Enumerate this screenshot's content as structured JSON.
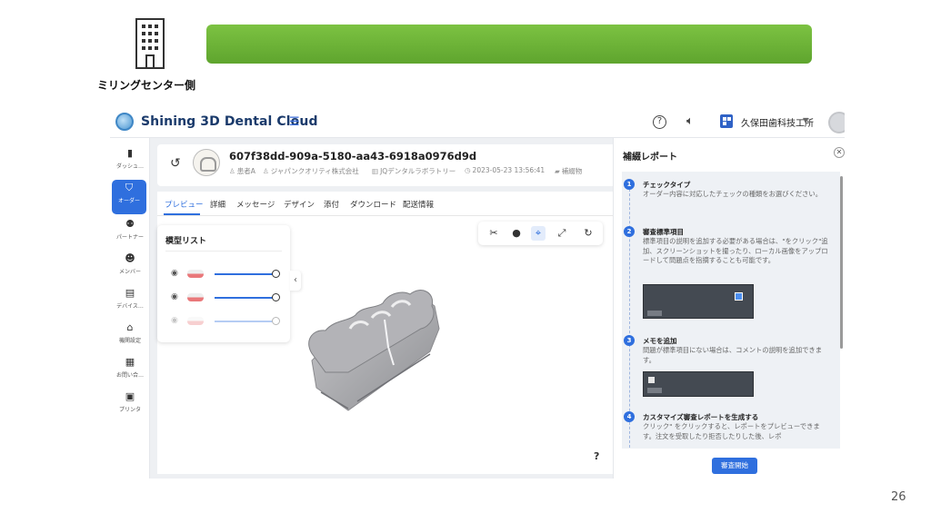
{
  "slide": {
    "label": "ミリングセンター側",
    "page_number": "26",
    "accent_color": "#6ab43a",
    "icon": "building-icon"
  },
  "header": {
    "app_title": "Shining 3D Dental Cloud",
    "company": "久保田歯科技工所"
  },
  "nav": {
    "items": [
      {
        "label": "ダッシュ…",
        "icon": "dashboard-icon"
      },
      {
        "label": "オーダー",
        "icon": "tooth-icon",
        "active": true
      },
      {
        "label": "パートナー",
        "icon": "partner-icon"
      },
      {
        "label": "メンバー",
        "icon": "members-icon"
      },
      {
        "label": "デバイス…",
        "icon": "device-icon"
      },
      {
        "label": "機関設定",
        "icon": "settings-home-icon"
      },
      {
        "label": "お問い合…",
        "icon": "contact-icon"
      },
      {
        "label": "プリンタ",
        "icon": "printer-icon"
      }
    ]
  },
  "order": {
    "id": "607f38dd-909a-5180-aa43-6918a0976d9d",
    "patient": "患者A",
    "clinic": "ジャパンクオリティ株式会社",
    "lab": "JQデンタルラボラトリー",
    "datetime": "2023-05-23 13:56:41",
    "type": "補綴物"
  },
  "tabs": [
    "プレビュー",
    "詳細",
    "メッセージ",
    "デザイン",
    "添付",
    "ダウンロード",
    "配送情報"
  ],
  "model_list": {
    "title": "模型リスト",
    "rows": [
      {
        "visible": true,
        "opacity": 1.0
      },
      {
        "visible": true,
        "opacity": 1.0
      },
      {
        "visible": false,
        "opacity": 0.0
      }
    ]
  },
  "viewer": {
    "help": "?"
  },
  "report": {
    "title": "補綴レポート",
    "start_button": "審査開始",
    "steps": [
      {
        "num": "1",
        "title": "チェックタイプ",
        "desc": "オーダー内容に対応したチェックの種類をお選びください。"
      },
      {
        "num": "2",
        "title": "審査標準項目",
        "desc": "標準項目の説明を追加する必要がある場合は、\"をクリック\"追加、スクリーンショットを撮ったり、ローカル画像をアップロードして問題点を指摘することも可能です。"
      },
      {
        "num": "3",
        "title": "メモを追加",
        "desc": "問題が標準項目にない場合は、コメントの説明を追加できます。"
      },
      {
        "num": "4",
        "title": "カスタマイズ審査レポートを生成する",
        "desc": "クリック\" をクリックすると、レポートをプレビューできます。注文を受取したり拒否したりした後、レポ"
      }
    ]
  }
}
